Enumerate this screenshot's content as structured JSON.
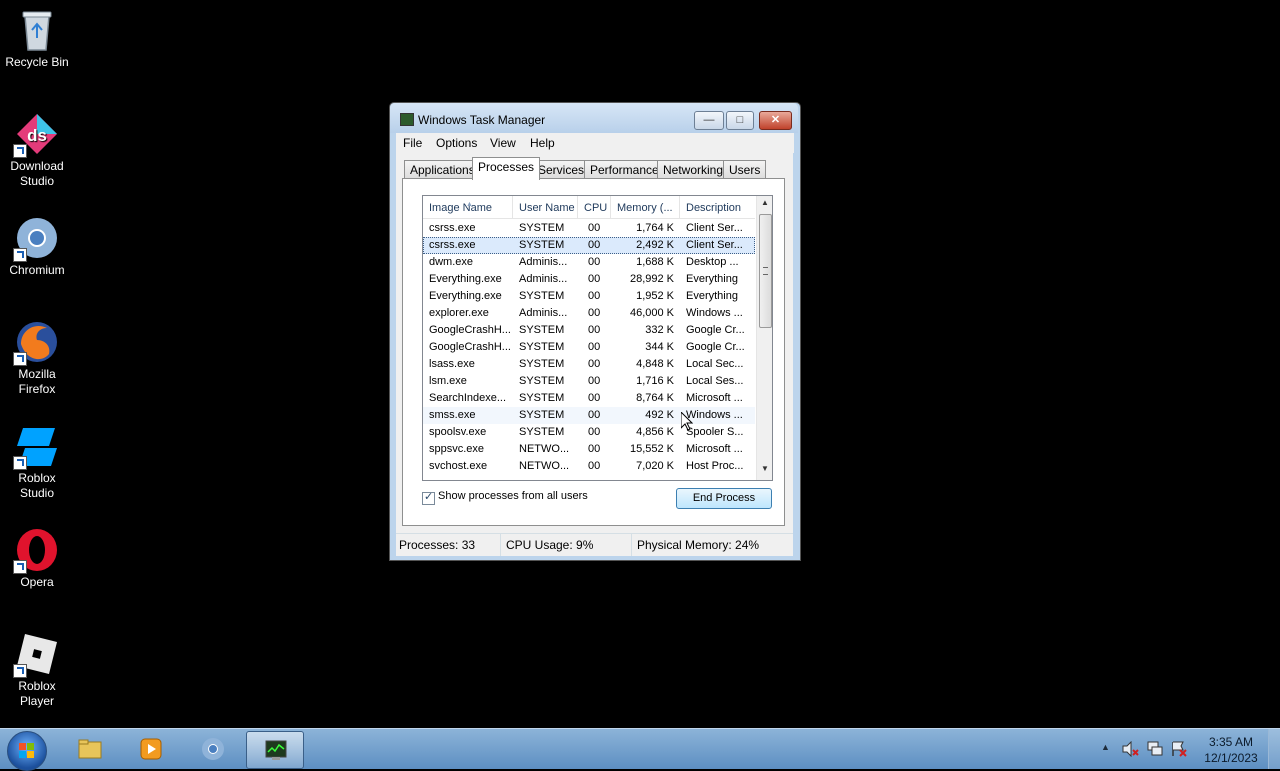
{
  "desktop": {
    "icons": [
      {
        "label": "Recycle Bin",
        "icon": "recycle-bin-icon"
      },
      {
        "label": "Download Studio",
        "icon": "download-studio-icon"
      },
      {
        "label": "Chromium",
        "icon": "chromium-icon"
      },
      {
        "label": "Mozilla Firefox",
        "icon": "firefox-icon"
      },
      {
        "label": "Roblox Studio",
        "icon": "roblox-studio-icon"
      },
      {
        "label": "Opera",
        "icon": "opera-icon"
      },
      {
        "label": "Roblox Player",
        "icon": "roblox-player-icon"
      }
    ]
  },
  "window": {
    "title": "Windows Task Manager",
    "menu": [
      "File",
      "Options",
      "View",
      "Help"
    ],
    "tabs": [
      "Applications",
      "Processes",
      "Services",
      "Performance",
      "Networking",
      "Users"
    ],
    "active_tab": "Processes",
    "columns": [
      "Image Name",
      "User Name",
      "CPU",
      "Memory (...",
      "Description"
    ],
    "rows": [
      {
        "name": "csrss.exe",
        "user": "SYSTEM",
        "cpu": "00",
        "mem": "1,764 K",
        "desc": "Client Ser..."
      },
      {
        "name": "csrss.exe",
        "user": "SYSTEM",
        "cpu": "00",
        "mem": "2,492 K",
        "desc": "Client Ser..."
      },
      {
        "name": "dwm.exe",
        "user": "Adminis...",
        "cpu": "00",
        "mem": "1,688 K",
        "desc": "Desktop ..."
      },
      {
        "name": "Everything.exe",
        "user": "Adminis...",
        "cpu": "00",
        "mem": "28,992 K",
        "desc": "Everything"
      },
      {
        "name": "Everything.exe",
        "user": "SYSTEM",
        "cpu": "00",
        "mem": "1,952 K",
        "desc": "Everything"
      },
      {
        "name": "explorer.exe",
        "user": "Adminis...",
        "cpu": "00",
        "mem": "46,000 K",
        "desc": "Windows ..."
      },
      {
        "name": "GoogleCrashH...",
        "user": "SYSTEM",
        "cpu": "00",
        "mem": "332 K",
        "desc": "Google Cr..."
      },
      {
        "name": "GoogleCrashH...",
        "user": "SYSTEM",
        "cpu": "00",
        "mem": "344 K",
        "desc": "Google Cr..."
      },
      {
        "name": "lsass.exe",
        "user": "SYSTEM",
        "cpu": "00",
        "mem": "4,848 K",
        "desc": "Local Sec..."
      },
      {
        "name": "lsm.exe",
        "user": "SYSTEM",
        "cpu": "00",
        "mem": "1,716 K",
        "desc": "Local Ses..."
      },
      {
        "name": "SearchIndexe...",
        "user": "SYSTEM",
        "cpu": "00",
        "mem": "8,764 K",
        "desc": "Microsoft ..."
      },
      {
        "name": "smss.exe",
        "user": "SYSTEM",
        "cpu": "00",
        "mem": "492 K",
        "desc": "Windows ..."
      },
      {
        "name": "spoolsv.exe",
        "user": "SYSTEM",
        "cpu": "00",
        "mem": "4,856 K",
        "desc": "Spooler S..."
      },
      {
        "name": "sppsvc.exe",
        "user": "NETWO...",
        "cpu": "00",
        "mem": "15,552 K",
        "desc": "Microsoft ..."
      },
      {
        "name": "svchost.exe",
        "user": "NETWO...",
        "cpu": "00",
        "mem": "7,020 K",
        "desc": "Host Proc..."
      }
    ],
    "selected_row": 1,
    "hover_row": 11,
    "show_all_users_label": "Show processes from all users",
    "show_all_users_checked": true,
    "end_process_label": "End Process",
    "status": {
      "processes": "Processes: 33",
      "cpu": "CPU Usage: 9%",
      "memory": "Physical Memory: 24%"
    }
  },
  "taskbar": {
    "pinned": [
      "file-explorer-icon",
      "media-player-icon",
      "chromium-icon",
      "task-manager-icon"
    ],
    "active": "task-manager-icon",
    "tray": [
      "show-hidden-icons-icon",
      "volume-muted-icon",
      "network-icon",
      "action-center-icon"
    ],
    "time": "3:35 AM",
    "date": "12/1/2023"
  },
  "colors": {
    "selection": "#dbeafc",
    "taskbar": "#6e9ccb",
    "close_button": "#c0422b"
  }
}
